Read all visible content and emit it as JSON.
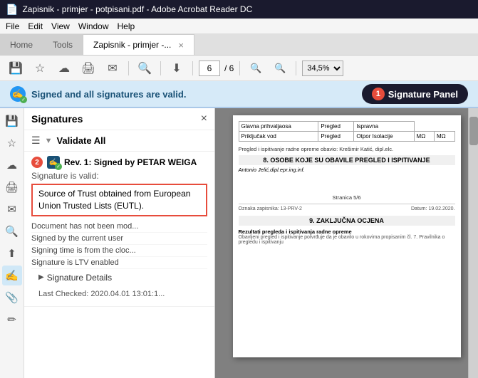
{
  "titleBar": {
    "title": "Zapisnik - primjer - potpisani.pdf - Adobe Acrobat Reader DC",
    "icon": "📄"
  },
  "menuBar": {
    "items": [
      "File",
      "Edit",
      "View",
      "Window",
      "Help"
    ]
  },
  "tabs": [
    {
      "id": "home",
      "label": "Home",
      "active": false
    },
    {
      "id": "tools",
      "label": "Tools",
      "active": false
    },
    {
      "id": "doc",
      "label": "Zapisnik - primjer -...",
      "active": true
    }
  ],
  "toolbar": {
    "pageInput": "6",
    "pageTotal": "/ 6",
    "zoom": "34,5%"
  },
  "signatureBanner": {
    "text": "Signed and all signatures are valid.",
    "buttonLabel": "Signature Panel",
    "badgeNumber": "1"
  },
  "signaturesPanel": {
    "title": "Signatures",
    "validateAllLabel": "Validate All",
    "signature": {
      "revLabel": "Rev. 1: Signed by PETAR WEIGA",
      "validLabel": "Signature is valid:",
      "trustText": "Source of Trust obtained from European Union Trusted Lists (EUTL).",
      "details": [
        "Document has not been mod...",
        "Signed by the current user",
        "Signing time is from the cloc...",
        "Signature is LTV enabled"
      ],
      "detailsLabel": "Signature Details",
      "lastChecked": "Last Checked: 2020.04.01 13:01:1..."
    },
    "badgeNumber": "2"
  },
  "pdfContent": {
    "tableRows": [
      [
        "Glavna prihvaljaosa",
        "Pregled",
        "Ispravna"
      ],
      [
        "Priključak vod",
        "Pregled",
        "Otpor Isolacije",
        "MΩ",
        "MΩ"
      ]
    ],
    "section8Title": "8. OSOBE KOJE SU OBAVILE PREGLED I ISPITIVANJE",
    "inspectorName": "Antonio Jelić,dipl.epr.ing.inf.",
    "pageInfo": "Stranica 5/6",
    "footerLeft": "Oznaka zapisnika: 13-PRV-2",
    "footerRight": "Datum: 19.02.2020.",
    "section9Title": "9. ZAKLJUČNA OCJENA",
    "section9Bold": "Rezultati pregleda i ispitivanja radne opreme",
    "section9Small": "Obavljeni pregled i ispitivanje potvrđuje da je obavilo u rokovima propisanim čl. 7. Pravilnika o pregledu i ispitivanju",
    "scrollbarVisible": true
  },
  "leftTools": [
    {
      "icon": "💾",
      "name": "save-tool"
    },
    {
      "icon": "☆",
      "name": "bookmark-tool"
    },
    {
      "icon": "☁",
      "name": "cloud-tool"
    },
    {
      "icon": "🖨",
      "name": "print-tool"
    },
    {
      "icon": "✉",
      "name": "email-tool"
    },
    {
      "icon": "🔍",
      "name": "search-tool"
    },
    {
      "icon": "↑",
      "name": "upload-tool"
    },
    {
      "icon": "✍",
      "name": "sign-tool"
    },
    {
      "icon": "📎",
      "name": "attach-tool"
    },
    {
      "icon": "✏",
      "name": "edit-tool"
    }
  ]
}
